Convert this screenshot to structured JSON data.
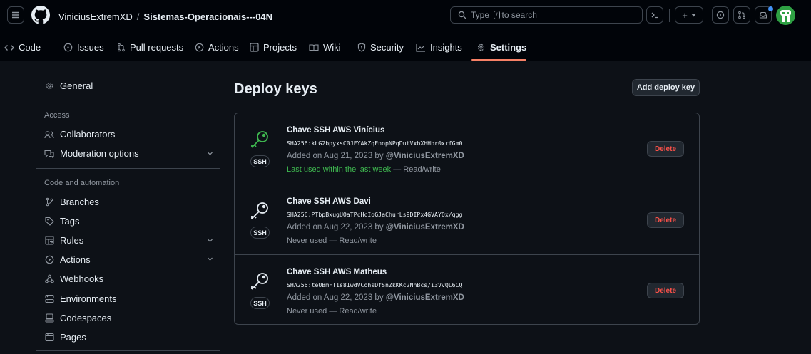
{
  "header": {
    "owner": "ViniciusExtremXD",
    "separator": "/",
    "repo": "Sistemas-Operacionais---04N",
    "search_prefix": "Type",
    "search_key": "/",
    "search_suffix": "to search",
    "create_label": "+"
  },
  "nav": {
    "tabs": [
      {
        "label": "Code",
        "icon": "code-icon"
      },
      {
        "label": "Issues",
        "icon": "issue-icon"
      },
      {
        "label": "Pull requests",
        "icon": "pull-request-icon"
      },
      {
        "label": "Actions",
        "icon": "play-icon"
      },
      {
        "label": "Projects",
        "icon": "table-icon"
      },
      {
        "label": "Wiki",
        "icon": "book-icon"
      },
      {
        "label": "Security",
        "icon": "shield-icon"
      },
      {
        "label": "Insights",
        "icon": "graph-icon"
      },
      {
        "label": "Settings",
        "icon": "gear-icon",
        "active": true
      }
    ]
  },
  "sidebar": {
    "general": "General",
    "access_heading": "Access",
    "collaborators": "Collaborators",
    "moderation": "Moderation options",
    "code_heading": "Code and automation",
    "branches": "Branches",
    "tags": "Tags",
    "rules": "Rules",
    "actions": "Actions",
    "webhooks": "Webhooks",
    "environments": "Environments",
    "codespaces": "Codespaces",
    "pages": "Pages"
  },
  "main": {
    "title": "Deploy keys",
    "add_button": "Add deploy key",
    "keys": [
      {
        "title": "Chave SSH AWS Vinícius",
        "fingerprint": "SHA256:kLG2bpyxsC0JFYAkZqEnopNPqDutVxbXHHbr0xrfGm0",
        "added_prefix": "Added on Aug 21, 2023 by",
        "added_by": "@ViniciusExtremXD",
        "usage_status": "Last used within the last week",
        "usage_suffix": "— Read/write",
        "badge": "SSH",
        "delete": "Delete",
        "active": true
      },
      {
        "title": "Chave SSH AWS Davi",
        "fingerprint": "SHA256:PTbpBxugUOaTPcHcIoGJaChurLs9DIPx4GVAYQx/qgg",
        "added_prefix": "Added on Aug 22, 2023 by",
        "added_by": "@ViniciusExtremXD",
        "usage_status": "Never used",
        "usage_suffix": "— Read/write",
        "badge": "SSH",
        "delete": "Delete",
        "active": false
      },
      {
        "title": "Chave SSH AWS Matheus",
        "fingerprint": "SHA256:teUBmFT1s81wdVCohsDfSnZkKKc2NnBcs/i3VvQL6CQ",
        "added_prefix": "Added on Aug 22, 2023 by",
        "added_by": "@ViniciusExtremXD",
        "usage_status": "Never used",
        "usage_suffix": "— Read/write",
        "badge": "SSH",
        "delete": "Delete",
        "active": false
      }
    ]
  },
  "colors": {
    "background": "#0d1117",
    "header_bg": "#010409",
    "border": "#3d444d",
    "accent_underline": "#f78166",
    "success_green": "#3fb950",
    "danger_red": "#f85149"
  }
}
